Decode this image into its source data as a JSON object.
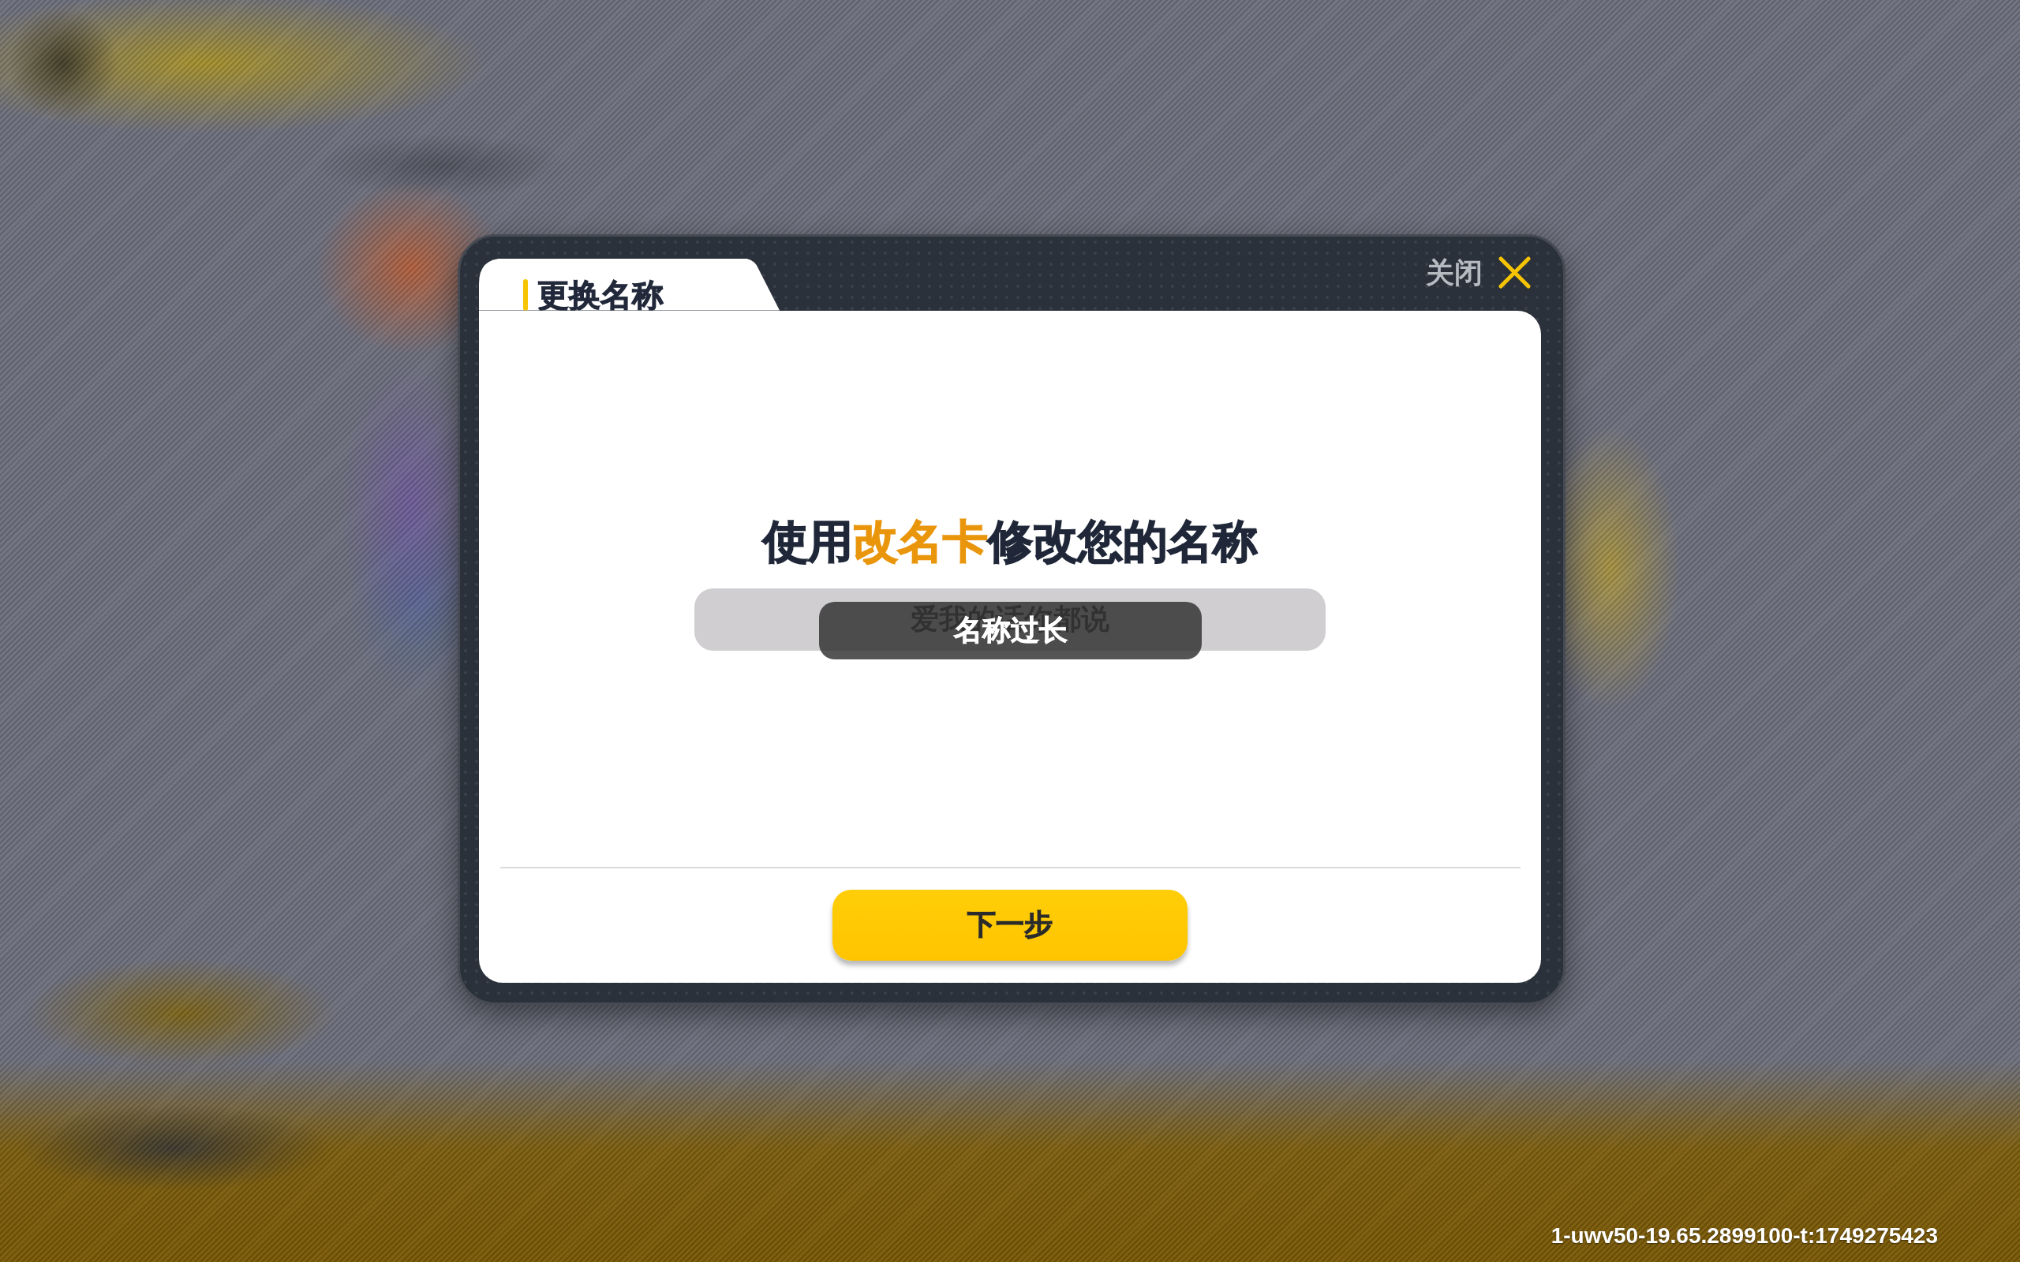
{
  "dialog": {
    "tab_title": "更换名称",
    "close_label": "关闭",
    "heading": [
      {
        "text": "使用",
        "highlight": false
      },
      {
        "text": "改名卡",
        "highlight": true
      },
      {
        "text": "修改您的名称",
        "highlight": false
      }
    ],
    "name_field": {
      "value": "爱我的话你都说"
    },
    "toast": "名称过长",
    "next_button": "下一步"
  },
  "build_info": "1-uwv50-19.65.2899100-t:1749275423"
}
